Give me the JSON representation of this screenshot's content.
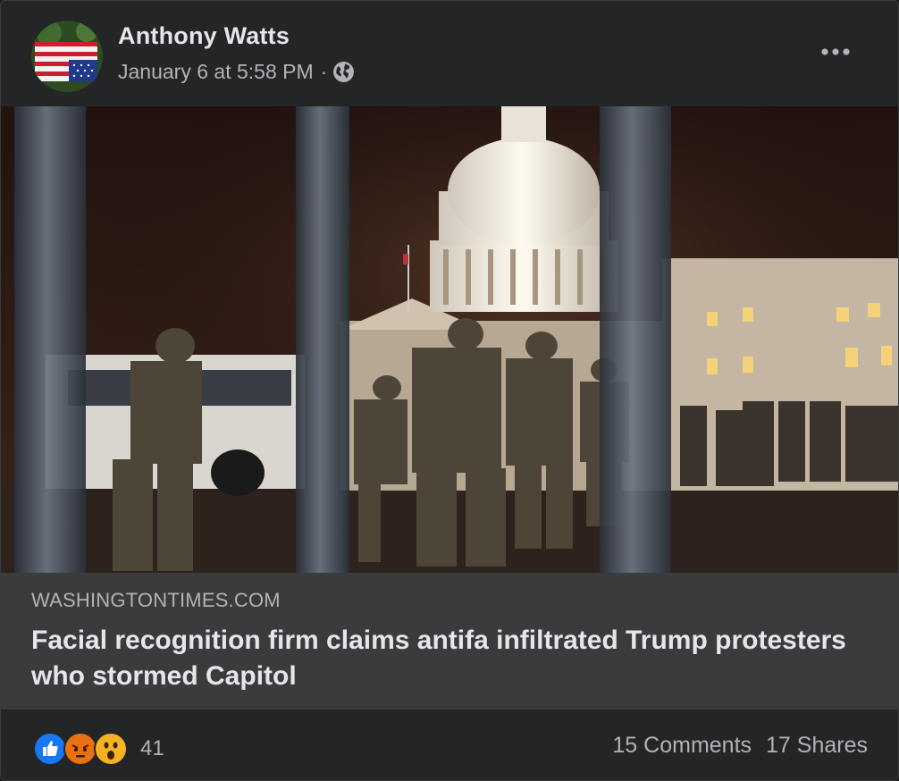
{
  "post": {
    "author": "Anthony Watts",
    "timestamp": "January 6 at 5:58 PM",
    "separator": "·",
    "privacy_icon": "globe-icon",
    "more_icon": "more-options-icon"
  },
  "link_preview": {
    "domain": "WASHINGTONTIMES.COM",
    "headline": "Facial recognition firm claims antifa infiltrated Trump protesters who stormed Capitol"
  },
  "engagement": {
    "reaction_icons": [
      "like-icon",
      "angry-icon",
      "wow-icon"
    ],
    "reaction_count": "41",
    "comments": "15 Comments",
    "shares": "17 Shares"
  },
  "colors": {
    "card_bg": "#242526",
    "link_box_bg": "#3a3b3c",
    "primary_text": "#e4e6eb",
    "secondary_text": "#b0b3b8",
    "like_blue": "#1877f2",
    "angry_orange": "#e9710f",
    "wow_yellow": "#f7b125"
  }
}
